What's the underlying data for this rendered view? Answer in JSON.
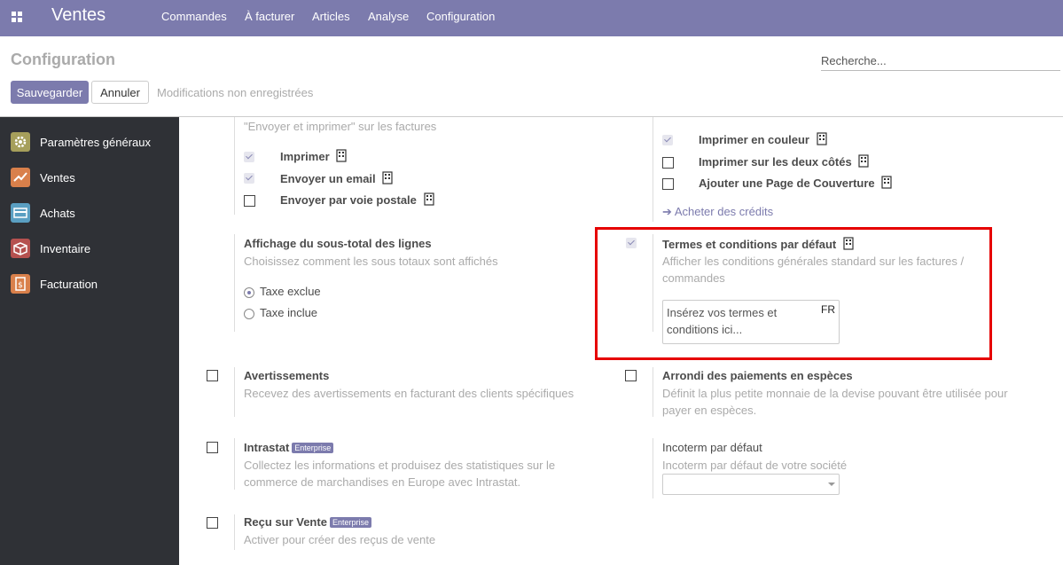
{
  "topbar": {
    "app_title": "Ventes",
    "menu": [
      "Commandes",
      "À facturer",
      "Articles",
      "Analyse",
      "Configuration"
    ]
  },
  "control_panel": {
    "breadcrumb": "Configuration",
    "search_placeholder": "Recherche...",
    "save_label": "Sauvegarder",
    "cancel_label": "Annuler",
    "unsaved_label": "Modifications non enregistrées"
  },
  "sidebar": {
    "items": [
      {
        "label": "Paramètres généraux",
        "icon": "gear-icon",
        "color": "#a69f5b"
      },
      {
        "label": "Ventes",
        "icon": "sales-chart-icon",
        "color": "#d9804b"
      },
      {
        "label": "Achats",
        "icon": "purchase-card-icon",
        "color": "#5a9fc2"
      },
      {
        "label": "Inventaire",
        "icon": "inventory-box-icon",
        "color": "#b5514f"
      },
      {
        "label": "Facturation",
        "icon": "invoice-icon",
        "color": "#d9804b",
        "active": true
      }
    ]
  },
  "settings": {
    "send_print_desc": "\"Envoyer et imprimer\" sur les factures",
    "print_label": "Imprimer",
    "send_email_label": "Envoyer un email",
    "send_post_label": "Envoyer par voie postale",
    "print_color_label": "Imprimer en couleur",
    "print_both_sides_label": "Imprimer sur les deux côtés",
    "cover_page_label": "Ajouter une Page de Couverture",
    "buy_credits_label": "Acheter des crédits",
    "subtotal_title": "Affichage du sous-total des lignes",
    "subtotal_desc": "Choisissez comment les sous totaux sont affichés",
    "tax_excluded_label": "Taxe exclue",
    "tax_included_label": "Taxe inclue",
    "terms_title": "Termes et conditions par défaut",
    "terms_desc_1": "Afficher les conditions générales standard sur les factures /",
    "terms_desc_2": "commandes",
    "terms_placeholder": "Insérez vos termes et conditions ici...",
    "terms_lang": "FR",
    "warnings_title": "Avertissements",
    "warnings_desc": "Recevez des avertissements en facturant des clients spécifiques",
    "rounding_title": "Arrondi des paiements en espèces",
    "rounding_desc_1": "Définit la plus petite monnaie de la devise pouvant être utilisée pour",
    "rounding_desc_2": "payer en espèces.",
    "intrastat_title": "Intrastat",
    "intrastat_badge": "Enterprise",
    "intrastat_desc_1": "Collectez les informations et produisez des statistiques sur le",
    "intrastat_desc_2": "commerce de marchandises en Europe avec Intrastat.",
    "incoterm_title": "Incoterm par défaut",
    "incoterm_desc": "Incoterm par défaut de votre société",
    "incoterm_value": "",
    "receipt_title": "Reçu sur Vente",
    "receipt_badge": "Enterprise",
    "receipt_desc": "Activer pour créer des reçus de vente"
  },
  "colors": {
    "accent": "#7c7bad",
    "sidebar_bg": "#2f3136",
    "highlight": "#e60000"
  }
}
